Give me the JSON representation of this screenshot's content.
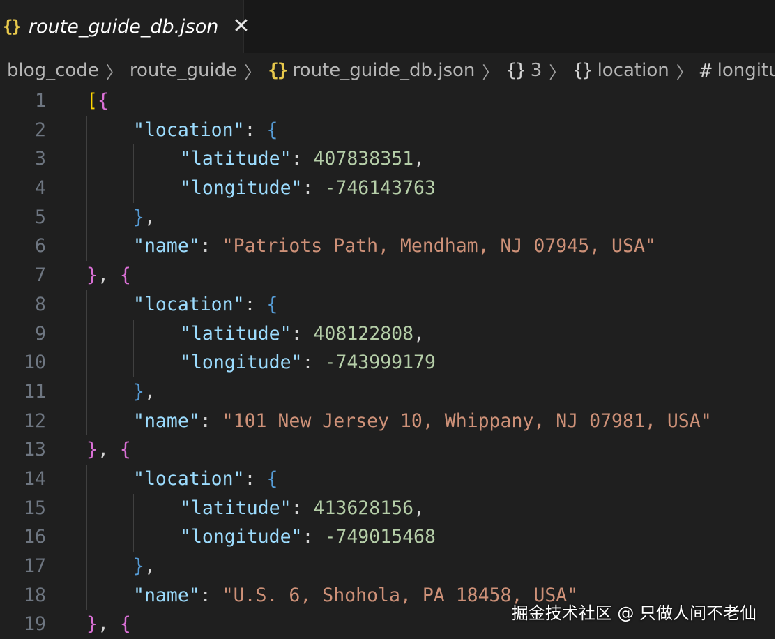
{
  "tab": {
    "label": "route_guide_db.json",
    "icon": "{}",
    "close": "✕"
  },
  "breadcrumb": {
    "items": [
      {
        "label": "blog_code",
        "icon": ""
      },
      {
        "label": "route_guide",
        "icon": ""
      },
      {
        "label": "route_guide_db.json",
        "icon": "{}"
      },
      {
        "label": "3",
        "icon": "{}"
      },
      {
        "label": "location",
        "icon": "{}"
      },
      {
        "label": "longitude",
        "icon": "#"
      }
    ]
  },
  "code": {
    "lines": [
      {
        "n": "1",
        "indent": 0,
        "tokens": [
          [
            "b1",
            "["
          ],
          [
            "b2",
            "{"
          ]
        ]
      },
      {
        "n": "2",
        "indent": 1,
        "tokens": [
          [
            "k",
            "\"location\""
          ],
          [
            "p",
            ": "
          ],
          [
            "b3",
            "{"
          ]
        ]
      },
      {
        "n": "3",
        "indent": 2,
        "tokens": [
          [
            "k",
            "\"latitude\""
          ],
          [
            "p",
            ": "
          ],
          [
            "n",
            "407838351"
          ],
          [
            "p",
            ","
          ]
        ]
      },
      {
        "n": "4",
        "indent": 2,
        "tokens": [
          [
            "k",
            "\"longitude\""
          ],
          [
            "p",
            ": "
          ],
          [
            "n",
            "-746143763"
          ]
        ]
      },
      {
        "n": "5",
        "indent": 1,
        "tokens": [
          [
            "b3",
            "}"
          ],
          [
            "p",
            ","
          ]
        ]
      },
      {
        "n": "6",
        "indent": 1,
        "tokens": [
          [
            "k",
            "\"name\""
          ],
          [
            "p",
            ": "
          ],
          [
            "s",
            "\"Patriots Path, Mendham, NJ 07945, USA\""
          ]
        ]
      },
      {
        "n": "7",
        "indent": 0,
        "tokens": [
          [
            "b2",
            "}"
          ],
          [
            "p",
            ", "
          ],
          [
            "b2",
            "{"
          ]
        ]
      },
      {
        "n": "8",
        "indent": 1,
        "tokens": [
          [
            "k",
            "\"location\""
          ],
          [
            "p",
            ": "
          ],
          [
            "b3",
            "{"
          ]
        ]
      },
      {
        "n": "9",
        "indent": 2,
        "tokens": [
          [
            "k",
            "\"latitude\""
          ],
          [
            "p",
            ": "
          ],
          [
            "n",
            "408122808"
          ],
          [
            "p",
            ","
          ]
        ]
      },
      {
        "n": "10",
        "indent": 2,
        "tokens": [
          [
            "k",
            "\"longitude\""
          ],
          [
            "p",
            ": "
          ],
          [
            "n",
            "-743999179"
          ]
        ]
      },
      {
        "n": "11",
        "indent": 1,
        "tokens": [
          [
            "b3",
            "}"
          ],
          [
            "p",
            ","
          ]
        ]
      },
      {
        "n": "12",
        "indent": 1,
        "tokens": [
          [
            "k",
            "\"name\""
          ],
          [
            "p",
            ": "
          ],
          [
            "s",
            "\"101 New Jersey 10, Whippany, NJ 07981, USA\""
          ]
        ]
      },
      {
        "n": "13",
        "indent": 0,
        "tokens": [
          [
            "b2",
            "}"
          ],
          [
            "p",
            ", "
          ],
          [
            "b2",
            "{"
          ]
        ]
      },
      {
        "n": "14",
        "indent": 1,
        "tokens": [
          [
            "k",
            "\"location\""
          ],
          [
            "p",
            ": "
          ],
          [
            "b3",
            "{"
          ]
        ]
      },
      {
        "n": "15",
        "indent": 2,
        "tokens": [
          [
            "k",
            "\"latitude\""
          ],
          [
            "p",
            ": "
          ],
          [
            "n",
            "413628156"
          ],
          [
            "p",
            ","
          ]
        ]
      },
      {
        "n": "16",
        "indent": 2,
        "tokens": [
          [
            "k",
            "\"longitude\""
          ],
          [
            "p",
            ": "
          ],
          [
            "n",
            "-749015468"
          ]
        ]
      },
      {
        "n": "17",
        "indent": 1,
        "tokens": [
          [
            "b3",
            "}"
          ],
          [
            "p",
            ","
          ]
        ]
      },
      {
        "n": "18",
        "indent": 1,
        "tokens": [
          [
            "k",
            "\"name\""
          ],
          [
            "p",
            ": "
          ],
          [
            "s",
            "\"U.S. 6, Shohola, PA 18458, USA\""
          ]
        ]
      },
      {
        "n": "19",
        "indent": 0,
        "tokens": [
          [
            "b2",
            "}"
          ],
          [
            "p",
            ", "
          ],
          [
            "b2",
            "{"
          ]
        ]
      }
    ]
  },
  "watermark": "掘金技术社区 @ 只做人间不老仙"
}
